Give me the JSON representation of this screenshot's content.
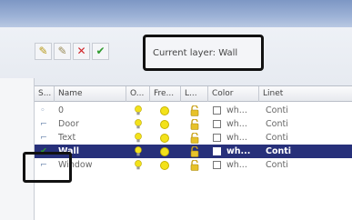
{
  "toolbar": {
    "buttons": [
      {
        "name": "new-layer-icon",
        "glyph": "✎",
        "color": "#b89a1a"
      },
      {
        "name": "new-layer-vp-icon",
        "glyph": "✎",
        "color": "#9a8c5a"
      },
      {
        "name": "delete-layer-icon",
        "glyph": "✕",
        "color": "#d0262b"
      },
      {
        "name": "set-current-icon",
        "glyph": "✔",
        "color": "#2f9b2f"
      }
    ]
  },
  "current_layer": "Current layer: Wall",
  "columns": [
    "S...",
    "Name",
    "O...",
    "Fre...",
    "L...",
    "Color",
    "Linet"
  ],
  "rows": [
    {
      "status": "◦",
      "name": "0",
      "color": "wh...",
      "linetype": "Conti",
      "selected": false
    },
    {
      "status": "⌐",
      "name": "Door",
      "color": "wh...",
      "linetype": "Conti",
      "selected": false
    },
    {
      "status": "⌐",
      "name": "Text",
      "color": "wh...",
      "linetype": "Conti",
      "selected": false
    },
    {
      "status": "✔",
      "name": "Wall",
      "color": "wh...",
      "linetype": "Conti",
      "selected": true
    },
    {
      "status": "⌐",
      "name": "Window",
      "color": "wh...",
      "linetype": "Conti",
      "selected": false
    }
  ],
  "colors": {
    "selected_row": "#27307a",
    "bulb": "#f3e21a",
    "current_check": "#2f9b2f"
  }
}
